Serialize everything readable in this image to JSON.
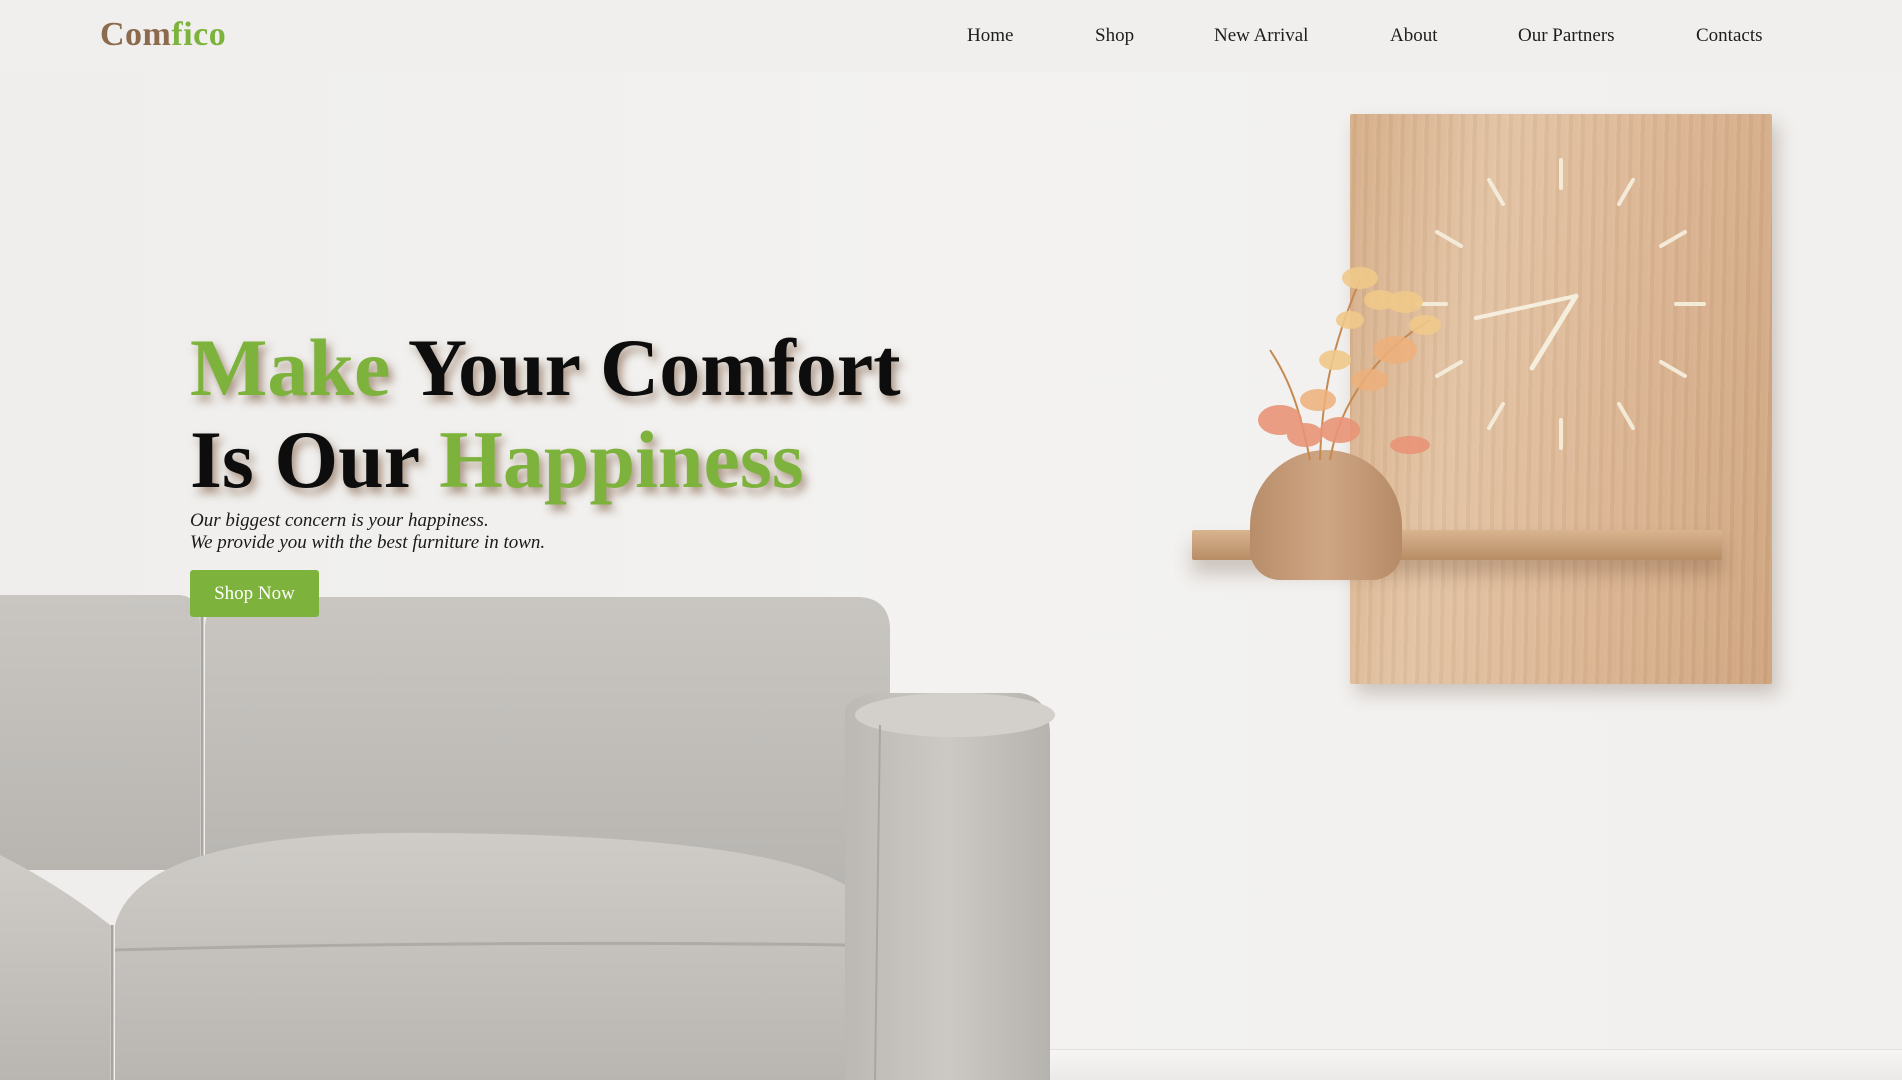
{
  "header": {
    "logo": {
      "part1": "Com",
      "part2": "fico"
    },
    "nav": [
      {
        "label": "Home"
      },
      {
        "label": "Shop"
      },
      {
        "label": "New Arrival"
      },
      {
        "label": "About"
      },
      {
        "label": "Our Partners"
      },
      {
        "label": "Contacts"
      }
    ]
  },
  "hero": {
    "title": {
      "line1_green": "Make",
      "line1_rest": "Your Comfort",
      "line2_dark": "Is Our",
      "line2_green": "Happiness"
    },
    "subtitle": {
      "line1": "Our biggest concern is your happiness.",
      "line2": "We provide you with the best furniture in town."
    },
    "cta_label": "Shop Now"
  },
  "colors": {
    "accent_green": "#7db33c",
    "logo_brown": "#8b6a4e",
    "background": "#efeeec",
    "text_dark": "#0d0d0d"
  },
  "icons": {
    "clock": "wall-clock-icon",
    "plant": "potted-plant-icon",
    "sofa": "sofa-illustration"
  }
}
